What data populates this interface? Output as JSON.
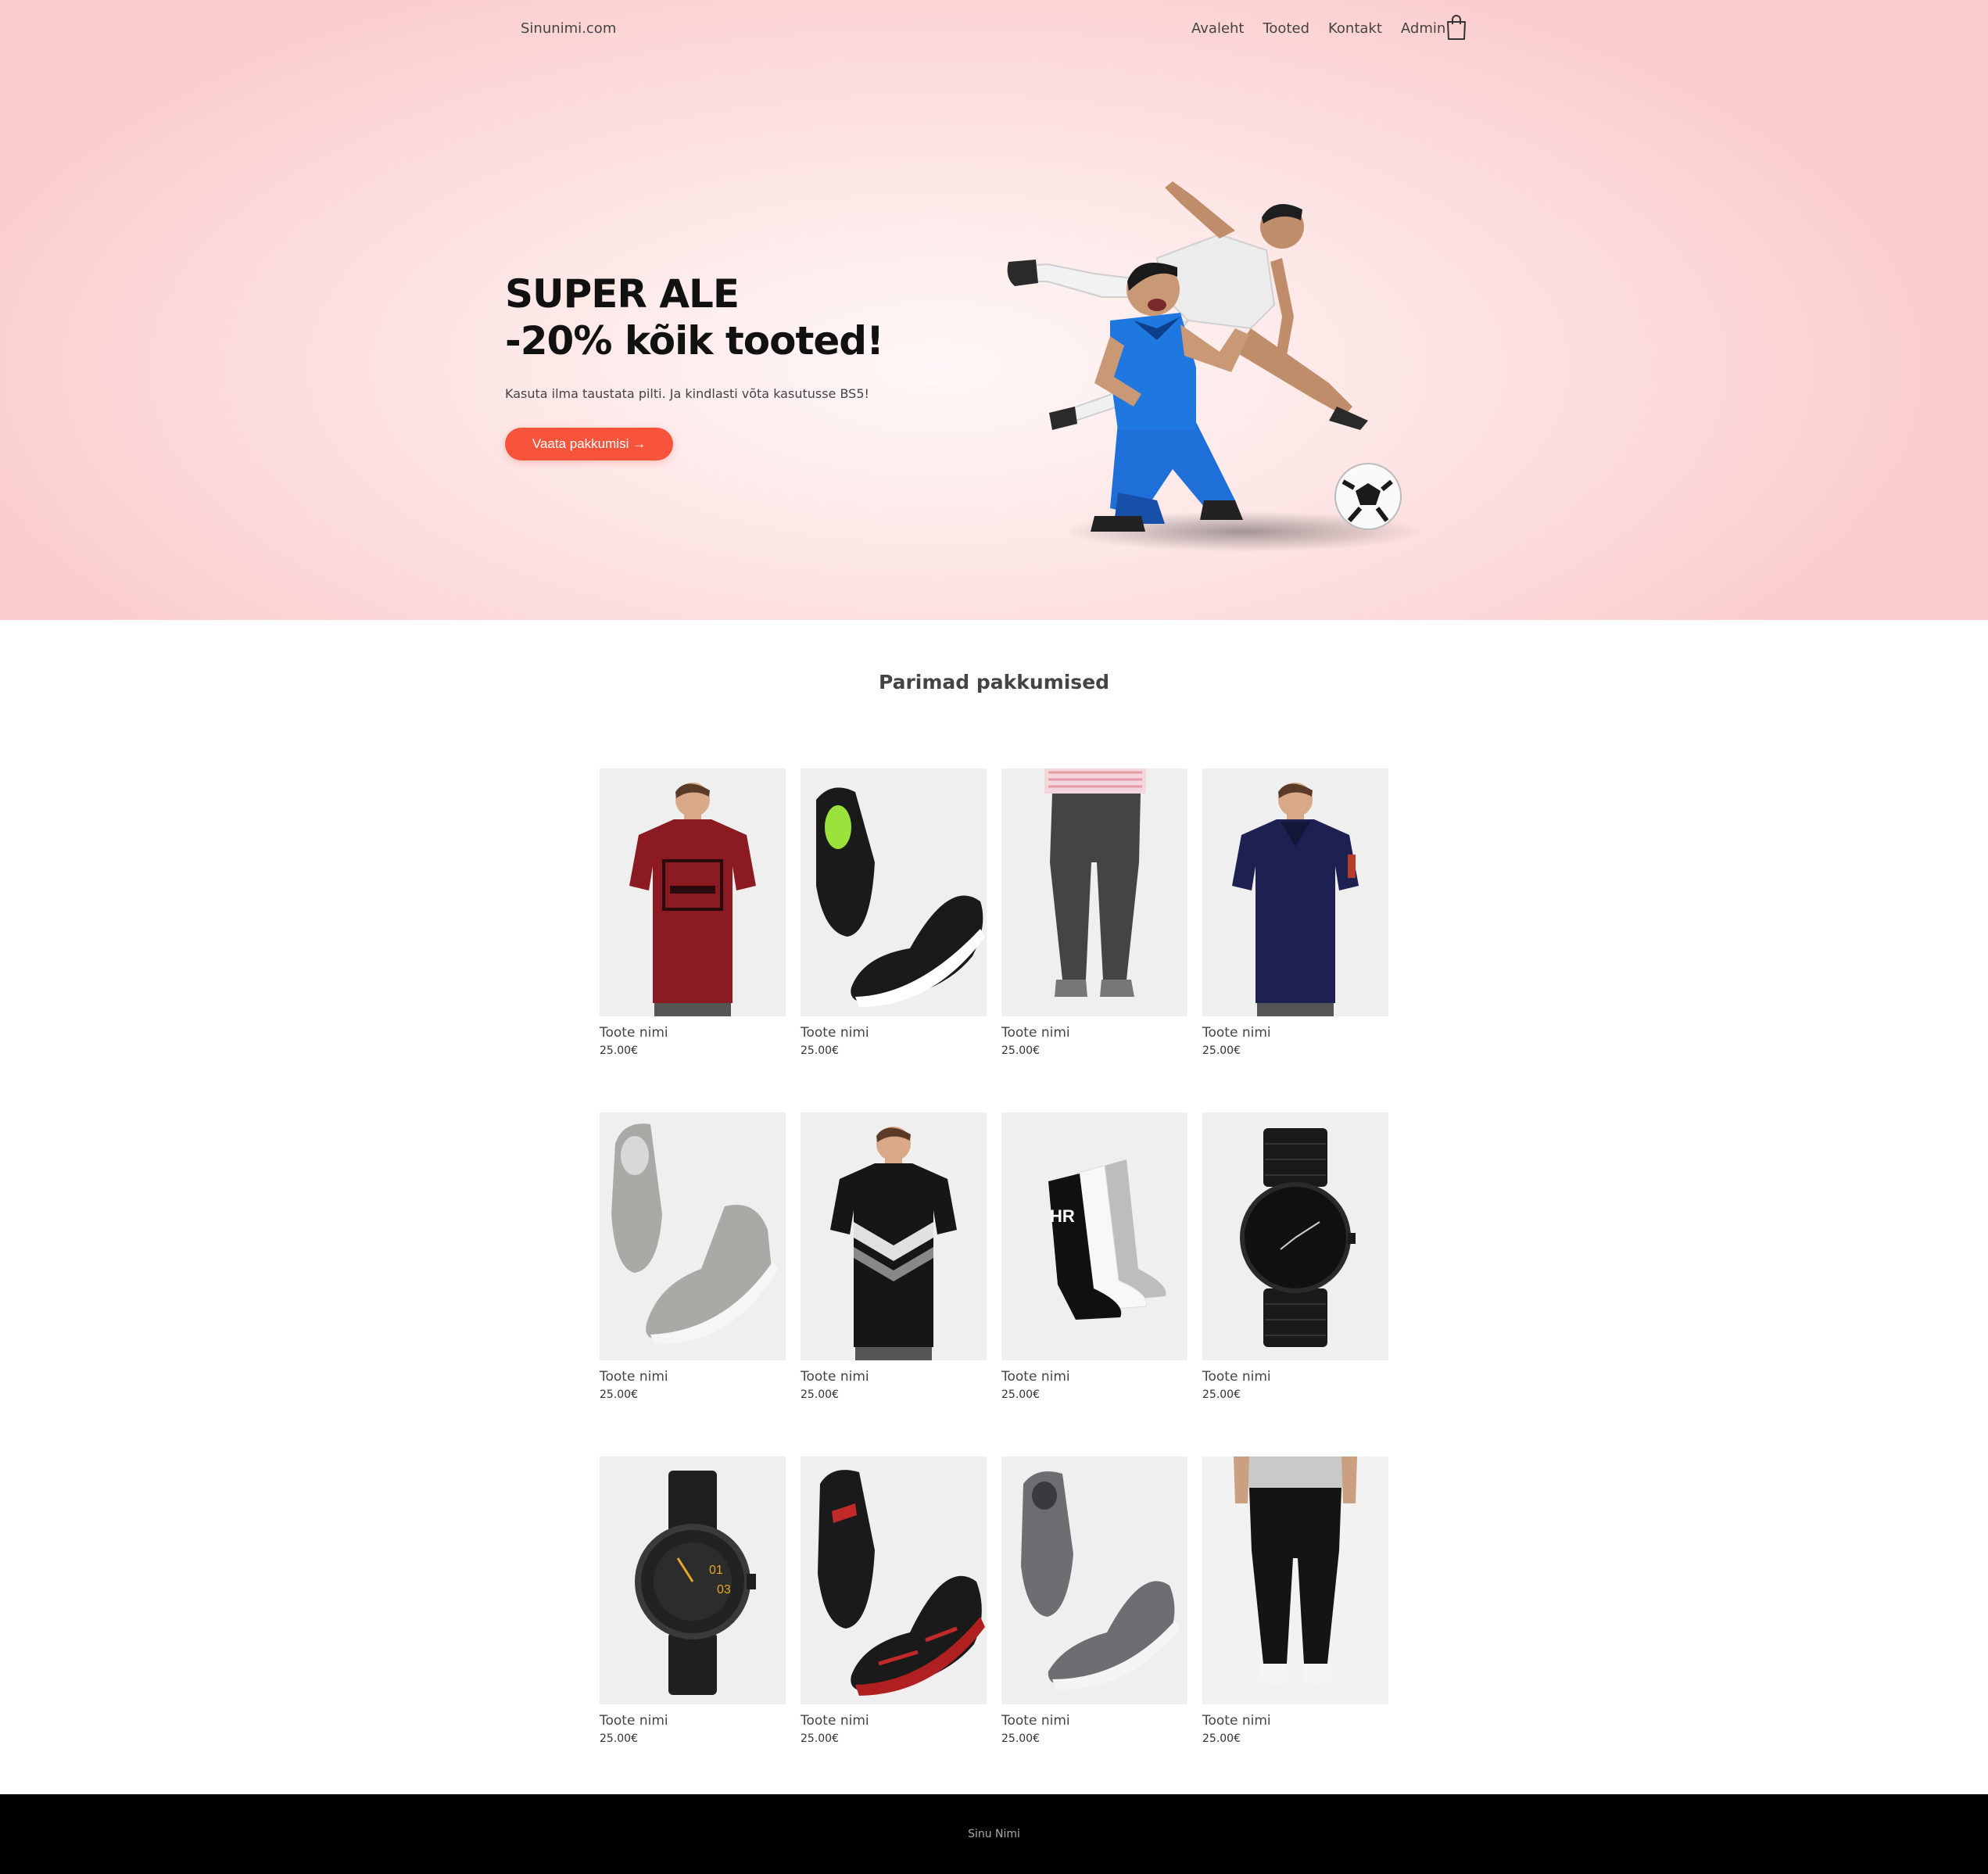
{
  "header": {
    "brand": "Sinunimi.com",
    "nav": [
      "Avaleht",
      "Tooted",
      "Kontakt",
      "Admin"
    ],
    "cart_icon": "shopping-bag-icon"
  },
  "hero": {
    "title_line1": "SUPER ALE",
    "title_line2": "-20% kõik tooted!",
    "subtitle": "Kasuta ilma taustata pilti. Ja kindlasti võta kasutusse BS5!",
    "button": "Vaata pakkumisi →",
    "button_color": "#f8533b",
    "image": "football-players"
  },
  "section": {
    "title": "Parimad pakkumised"
  },
  "products": [
    {
      "name": "Toote nimi",
      "price": "25.00€",
      "image": "red-tshirt"
    },
    {
      "name": "Toote nimi",
      "price": "25.00€",
      "image": "black-sneakers"
    },
    {
      "name": "Toote nimi",
      "price": "25.00€",
      "image": "grey-trousers"
    },
    {
      "name": "Toote nimi",
      "price": "25.00€",
      "image": "navy-polo"
    },
    {
      "name": "Toote nimi",
      "price": "25.00€",
      "image": "grey-high-tops"
    },
    {
      "name": "Toote nimi",
      "price": "25.00€",
      "image": "black-tshirt"
    },
    {
      "name": "Toote nimi",
      "price": "25.00€",
      "image": "socks"
    },
    {
      "name": "Toote nimi",
      "price": "25.00€",
      "image": "black-metal-watch"
    },
    {
      "name": "Toote nimi",
      "price": "25.00€",
      "image": "black-leather-watch"
    },
    {
      "name": "Toote nimi",
      "price": "25.00€",
      "image": "black-red-sneakers"
    },
    {
      "name": "Toote nimi",
      "price": "25.00€",
      "image": "grey-slip-on"
    },
    {
      "name": "Toote nimi",
      "price": "25.00€",
      "image": "black-joggers"
    }
  ],
  "footer": {
    "text": "Sinu Nimi"
  }
}
